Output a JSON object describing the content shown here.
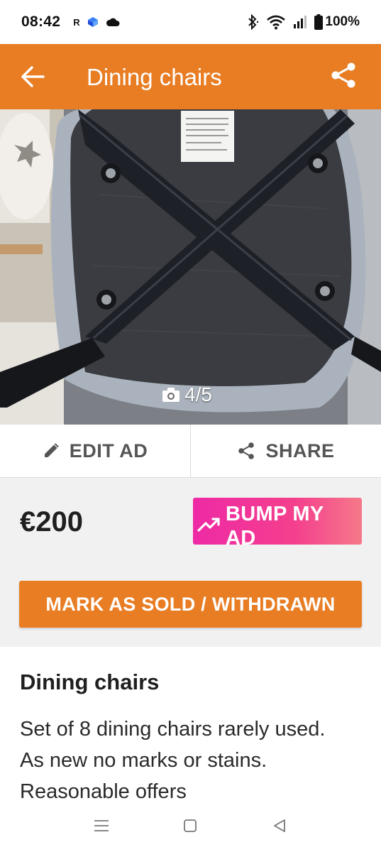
{
  "status_bar": {
    "time": "08:42",
    "left_icons": [
      "r-app-icon",
      "blue-cube-icon",
      "cloud-icon"
    ],
    "right_icons": [
      "bluetooth-icon",
      "wifi-icon",
      "signal-icon",
      "battery-icon"
    ],
    "battery": "100%",
    "r_label": "R"
  },
  "app_bar": {
    "title": "Dining chairs",
    "color": "#e87d24"
  },
  "photo": {
    "counter": "4/5"
  },
  "actions": {
    "edit_label": "EDIT AD",
    "share_label": "SHARE"
  },
  "listing": {
    "price": "€200",
    "bump_label": "BUMP MY AD",
    "sold_label": "MARK AS SOLD / WITHDRAWN",
    "title": "Dining chairs",
    "description": "Set of 8 dining chairs rarely used. As new no marks or stains. Reasonable offers"
  },
  "colors": {
    "accent": "#e87d24",
    "bump_gradient_start": "#ee2aa5",
    "bump_gradient_end": "#f6788a"
  }
}
